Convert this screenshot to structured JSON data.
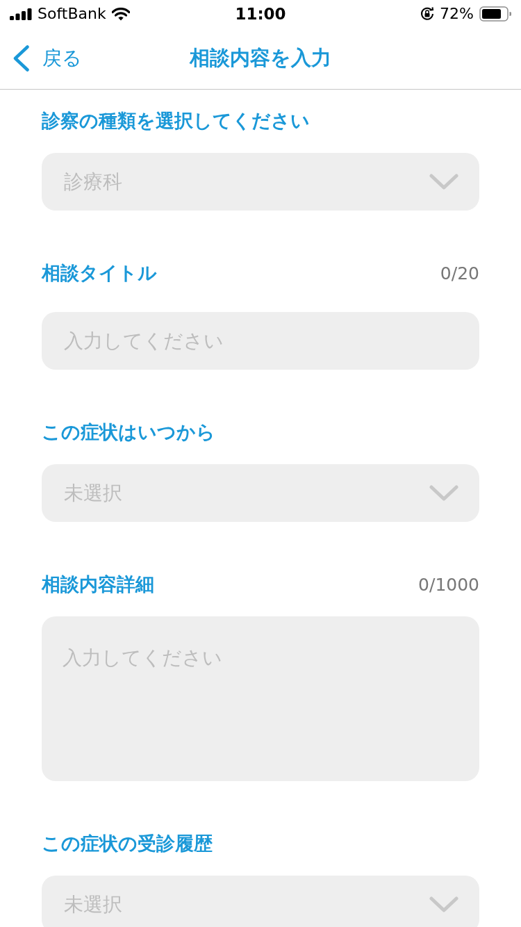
{
  "status_bar": {
    "carrier": "SoftBank",
    "time": "11:00",
    "battery_percent": "72%"
  },
  "nav_bar": {
    "back_label": "戻る",
    "title": "相談内容を入力"
  },
  "form": {
    "fields": [
      {
        "kind": "select",
        "label": "診察の種類を選択してください",
        "placeholder": "診療科"
      },
      {
        "kind": "text",
        "label": "相談タイトル",
        "counter": "0/20",
        "placeholder": "入力してください"
      },
      {
        "kind": "select",
        "label": "この症状はいつから",
        "placeholder": "未選択"
      },
      {
        "kind": "textarea",
        "label": "相談内容詳細",
        "counter": "0/1000",
        "placeholder": "入力してください"
      },
      {
        "kind": "select",
        "label": "この症状の受診履歴",
        "placeholder": "未選択"
      }
    ]
  }
}
